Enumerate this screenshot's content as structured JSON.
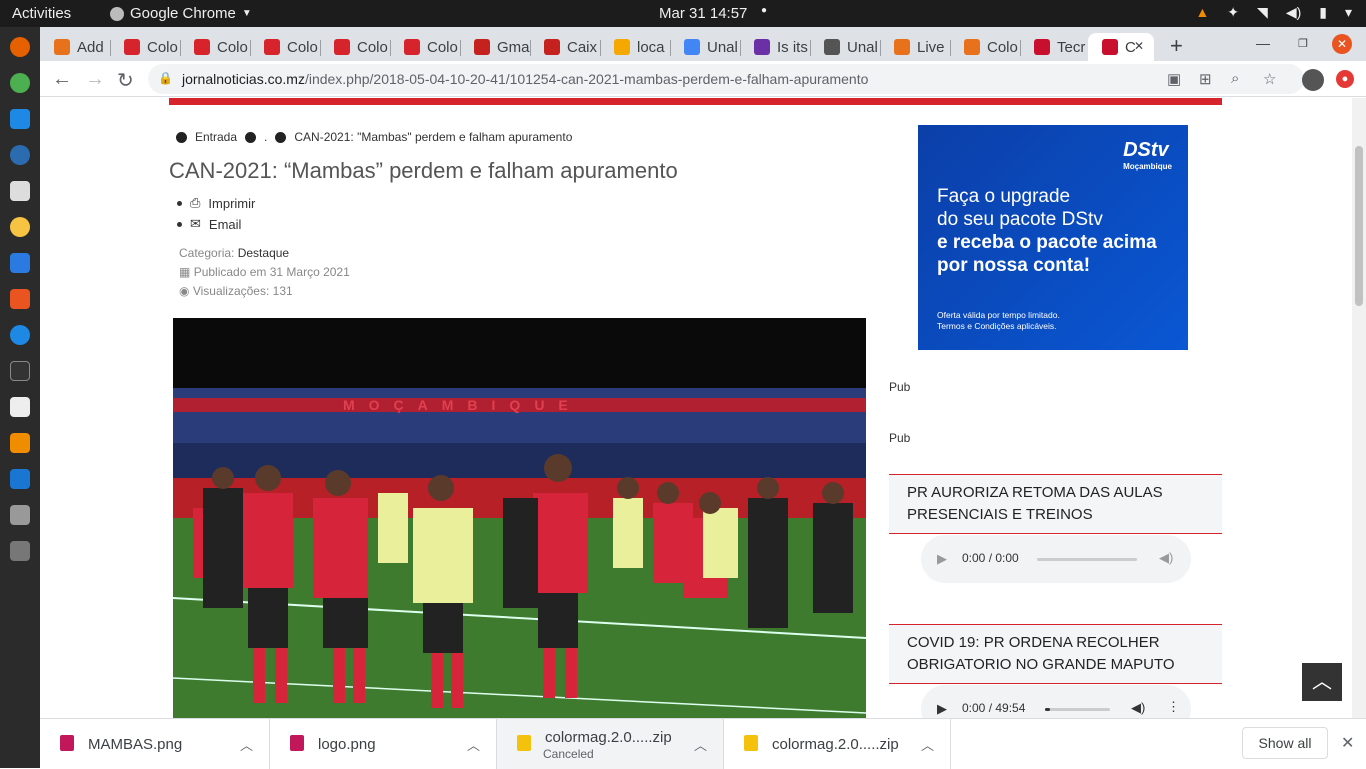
{
  "system": {
    "activities": "Activities",
    "app_name": "Google Chrome",
    "clock": "Mar 31  14:57"
  },
  "tabs": [
    {
      "label": "Add",
      "color": "#e8711c"
    },
    {
      "label": "Colo",
      "color": "#d7242c"
    },
    {
      "label": "Colo",
      "color": "#d7242c"
    },
    {
      "label": "Colo",
      "color": "#d7242c"
    },
    {
      "label": "Colo",
      "color": "#d7242c"
    },
    {
      "label": "Colo",
      "color": "#d7242c"
    },
    {
      "label": "Gma",
      "color": "#c5221f"
    },
    {
      "label": "Caix",
      "color": "#c5221f"
    },
    {
      "label": "loca",
      "color": "#f4a800"
    },
    {
      "label": "Unal",
      "color": "#4285f4"
    },
    {
      "label": "Is its",
      "color": "#6b2fa6"
    },
    {
      "label": "Unal",
      "color": "#555555"
    },
    {
      "label": "Live",
      "color": "#e8711c"
    },
    {
      "label": "Colo",
      "color": "#e8711c"
    },
    {
      "label": "Tecr",
      "color": "#c8102e"
    },
    {
      "label": "C",
      "color": "#c8102e"
    }
  ],
  "url": {
    "domain": "jornalnoticias.co.mz",
    "path": "/index.php/2018-05-04-10-20-41/101254-can-2021-mambas-perdem-e-falham-apuramento"
  },
  "article": {
    "breadcrumb": [
      "Entrada",
      ".",
      "CAN-2021: \"Mambas\" perdem e falham apuramento"
    ],
    "title": "CAN-2021: “Mambas” perdem e falham apuramento",
    "actions": {
      "print": "Imprimir",
      "email": "Email"
    },
    "category_label": "Categoria:",
    "category": "Destaque",
    "published": "Publicado em 31 Março 2021",
    "views": "Visualizações: 131",
    "photo_banner": "MOÇAMBIQUE"
  },
  "ad": {
    "brand": "DStv",
    "brand_sub": "Moçambique",
    "line1": "Faça o upgrade",
    "line2": "do seu pacote DStv",
    "line3": "e receba o pacote acima",
    "line4": "por nossa conta!",
    "fine1": "Oferta válida por tempo limitado.",
    "fine2": "Termos e Condições aplicáveis.",
    "color": "#0a57d4"
  },
  "sidebar": {
    "pub1": "Pub",
    "pub2": "Pub",
    "news": [
      {
        "title": "PR AURORIZA RETOMA DAS AULAS PRESENCIAIS E TREINOS",
        "audio_time": "0:00 / 0:00",
        "progress": 0
      },
      {
        "title": "COVID 19: PR ORDENA RECOLHER OBRIGATORIO NO GRANDE MAPUTO",
        "audio_time": "0:00 / 49:54",
        "progress": 0.08
      }
    ]
  },
  "downloads": {
    "items": [
      {
        "name": "MAMBAS.png",
        "status": ""
      },
      {
        "name": "logo.png",
        "status": ""
      },
      {
        "name": "colormag.2.0.....zip",
        "status": "Canceled"
      },
      {
        "name": "colormag.2.0.....zip",
        "status": ""
      }
    ],
    "show_all": "Show all"
  }
}
